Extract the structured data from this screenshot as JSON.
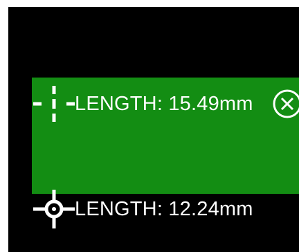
{
  "colors": {
    "background": "#000000",
    "panel": "#138d13",
    "foreground": "#ffffff"
  },
  "measurements": [
    {
      "icon": "dashed-crosshair-icon",
      "label": "LENGTH: 15.49mm",
      "selected": true,
      "action_icon": "close-circle-icon"
    },
    {
      "icon": "crosshair-target-icon",
      "label": "LENGTH: 12.24mm",
      "selected": false
    }
  ]
}
